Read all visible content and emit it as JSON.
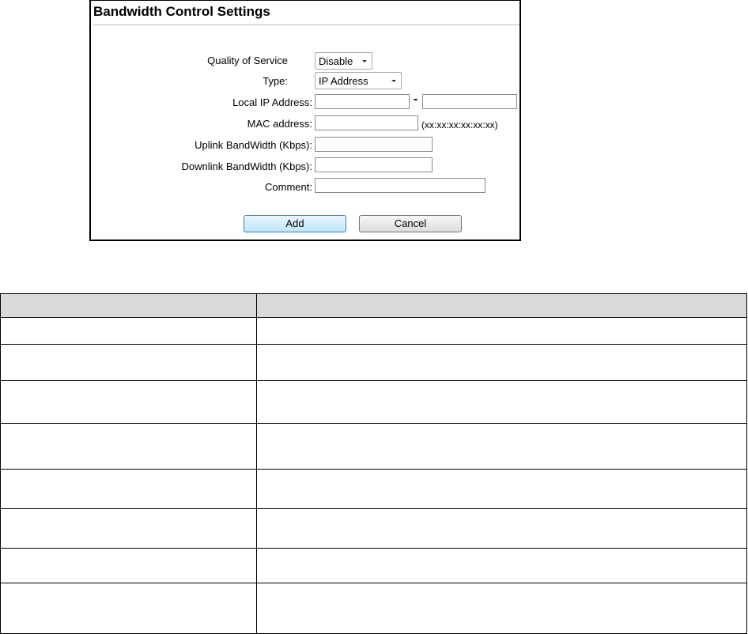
{
  "panel": {
    "title": "Bandwidth Control Settings",
    "qos_label": "Quality of Service",
    "qos_value": "Disable",
    "type_label": "Type:",
    "type_value": "IP Address",
    "local_ip_label": "Local IP Address:",
    "ip_separator": "-",
    "mac_label": "MAC address:",
    "mac_hint": "(xx:xx:xx:xx:xx:xx)",
    "uplink_label": "Uplink BandWidth (Kbps):",
    "downlink_label": "Downlink BandWidth (Kbps):",
    "comment_label": "Comment:",
    "add_label": "Add",
    "cancel_label": "Cancel"
  },
  "table": {
    "headers": [
      "",
      ""
    ],
    "rows": [
      [
        "",
        ""
      ],
      [
        "",
        ""
      ],
      [
        "",
        ""
      ],
      [
        "",
        ""
      ],
      [
        "",
        ""
      ],
      [
        "",
        ""
      ],
      [
        "",
        ""
      ]
    ]
  }
}
